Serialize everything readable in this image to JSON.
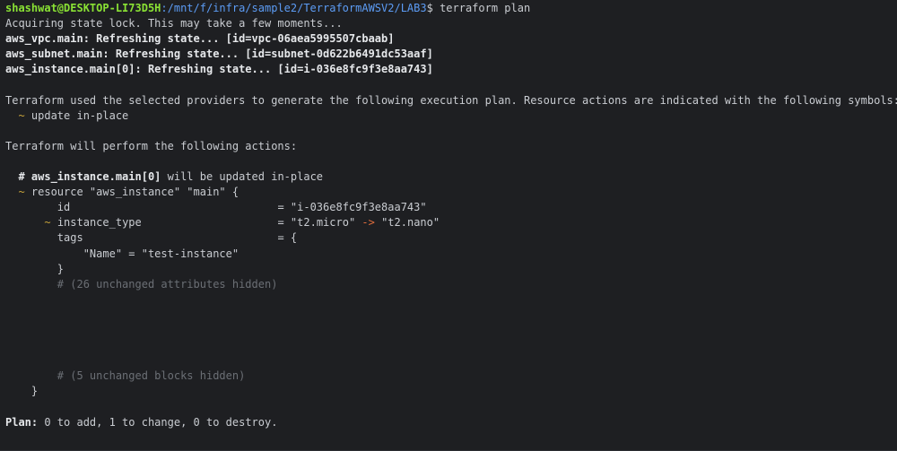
{
  "prompt": {
    "user_host": "shashwat@DESKTOP-LI73D5H",
    "path": ":/mnt/f/infra/sample2/TerraformAWSV2/LAB3",
    "symbol": "$ ",
    "command": "terraform plan"
  },
  "refresh": {
    "lock_msg": "Acquiring state lock. This may take a few moments...",
    "vpc": "aws_vpc.main: Refreshing state... [id=vpc-06aea5995507cbaab]",
    "subnet": "aws_subnet.main: Refreshing state... [id=subnet-0d622b6491dc53aaf]",
    "instance": "aws_instance.main[0]: Refreshing state... [id=i-036e8fc9f3e8aa743]"
  },
  "intro": {
    "line1": "Terraform used the selected providers to generate the following execution plan. Resource actions are indicated with the following symbols:",
    "update_symbol": "~",
    "update_label": " update in-place",
    "perform": "Terraform will perform the following actions:"
  },
  "resource": {
    "comment_hash": "# ",
    "address": "aws_instance.main[0]",
    "comment_rest": " will be updated in-place",
    "tilde": "~",
    "declaration": " resource \"aws_instance\" \"main\" {",
    "id_key": "id",
    "id_eq": "= ",
    "id_val": "\"i-036e8fc9f3e8aa743\"",
    "it_key": " instance_type",
    "it_eq": "= ",
    "it_old": "\"t2.micro\"",
    "it_arrow": " -> ",
    "it_new": "\"t2.nano\"",
    "tags_key": "tags",
    "tags_eq": "= {",
    "tag_name_line": "\"Name\" = \"test-instance\"",
    "tags_close": "}",
    "unchanged_attrs": "# (26 unchanged attributes hidden)",
    "unchanged_blocks": "# (5 unchanged blocks hidden)",
    "close": "}"
  },
  "summary": {
    "label": "Plan:",
    "text": " 0 to add, 1 to change, 0 to destroy."
  },
  "colors": {
    "background": "#1e1f22",
    "text": "#c9ccd1",
    "prompt_green": "#8ae234",
    "path_blue": "#5c9cf5",
    "tilde_yellow": "#c7a33a",
    "arrow_orange": "#e06c3c",
    "comment_dim": "#6b6f75"
  }
}
